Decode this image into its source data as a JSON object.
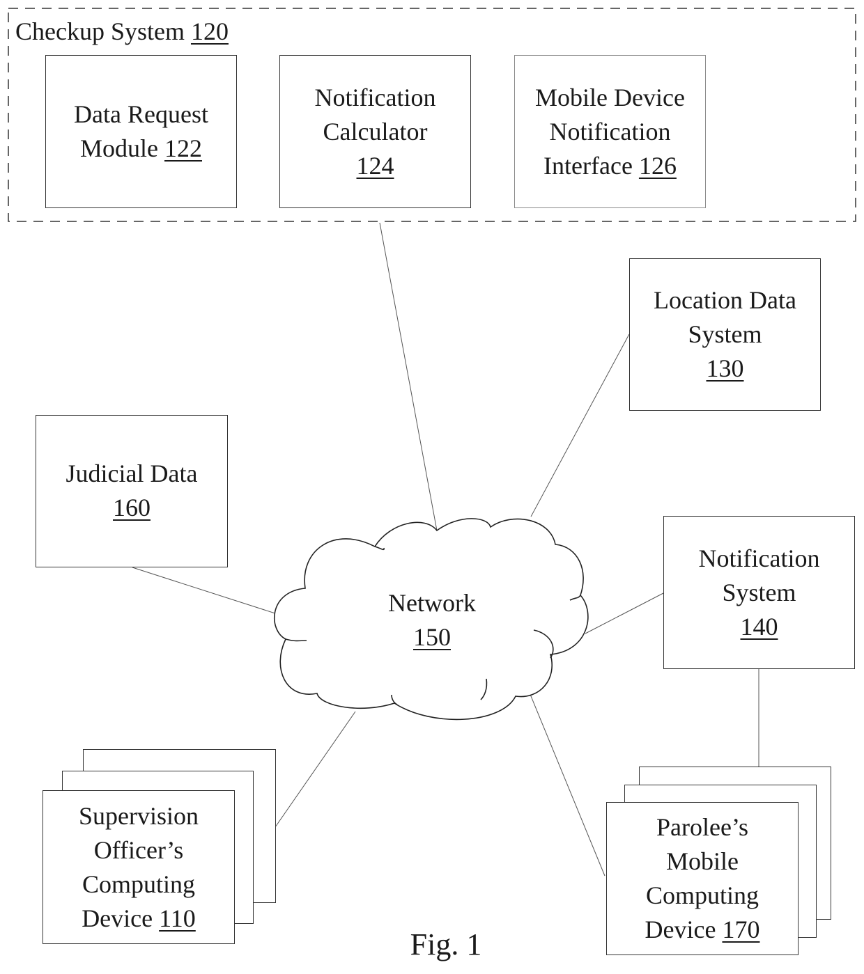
{
  "figure": {
    "caption": "Fig. 1"
  },
  "checkup_system": {
    "label": "Checkup System",
    "ref": "120",
    "modules": [
      {
        "lines": [
          "Data Request",
          "Module"
        ],
        "ref": "122"
      },
      {
        "lines": [
          "Notification",
          "Calculator"
        ],
        "ref": "124"
      },
      {
        "lines": [
          "Mobile Device",
          "Notification",
          "Interface"
        ],
        "ref": "126"
      }
    ]
  },
  "network": {
    "lines": [
      "Network"
    ],
    "ref": "150"
  },
  "nodes": {
    "location_data_system": {
      "lines": [
        "Location Data",
        "System"
      ],
      "ref": "130"
    },
    "judicial_data": {
      "lines": [
        "Judicial Data"
      ],
      "ref": "160"
    },
    "notification_system": {
      "lines": [
        "Notification",
        "System"
      ],
      "ref": "140"
    },
    "supervision_device": {
      "lines": [
        "Supervision",
        "Officer’s",
        "Computing",
        "Device"
      ],
      "ref": "110"
    },
    "parolee_device": {
      "lines": [
        "Parolee’s",
        "Mobile",
        "Computing",
        "Device"
      ],
      "ref": "170"
    }
  },
  "connections": [
    {
      "from": "checkup-system",
      "to": "network"
    },
    {
      "from": "location-data-system",
      "to": "network"
    },
    {
      "from": "judicial-data",
      "to": "network"
    },
    {
      "from": "notification-system",
      "to": "network"
    },
    {
      "from": "supervision-device",
      "to": "network"
    },
    {
      "from": "parolee-device",
      "to": "network"
    },
    {
      "from": "notification-system",
      "to": "parolee-device"
    }
  ]
}
